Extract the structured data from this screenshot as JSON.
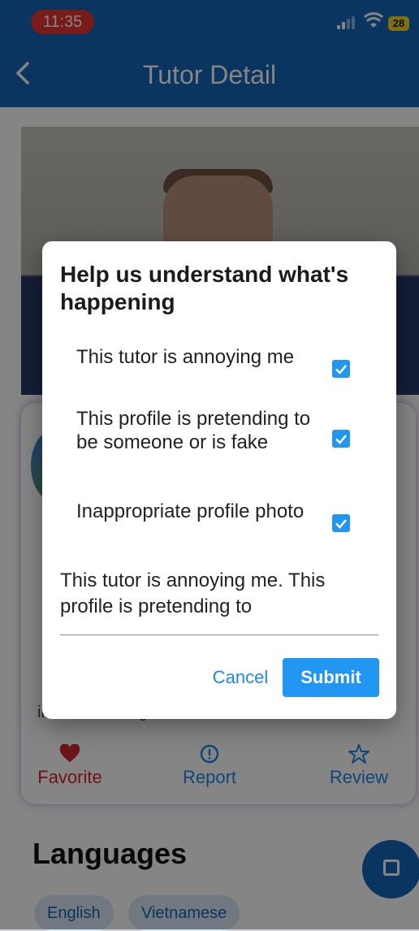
{
  "status_bar": {
    "time": "11:35",
    "battery": "28"
  },
  "app_bar": {
    "title": "Tutor Detail",
    "back_icon": "chevron-left-icon"
  },
  "tutor_card": {
    "bio_tail": "in and traveling around Southeast Asia.",
    "actions": [
      {
        "label": "Favorite",
        "icon": "heart-icon",
        "color": "#d0282e"
      },
      {
        "label": "Report",
        "icon": "alert-circle-icon",
        "color": "#1e88e5"
      },
      {
        "label": "Review",
        "icon": "star-outline-icon",
        "color": "#1e88e5"
      }
    ]
  },
  "languages": {
    "heading": "Languages",
    "chips": [
      "English",
      "Vietnamese"
    ]
  },
  "dialog": {
    "title": "Help us understand what's happening",
    "options": [
      {
        "label": "This tutor is annoying me",
        "checked": true
      },
      {
        "label": "This profile is pretending to be someone or is fake",
        "checked": true
      },
      {
        "label": "Inappropriate profile photo",
        "checked": true
      }
    ],
    "reason_text": "This tutor is annoying me. This profile is pretending to",
    "cancel_label": "Cancel",
    "submit_label": "Submit"
  },
  "colors": {
    "primary": "#1466b8",
    "accent": "#2196f3",
    "danger": "#d0282e"
  }
}
